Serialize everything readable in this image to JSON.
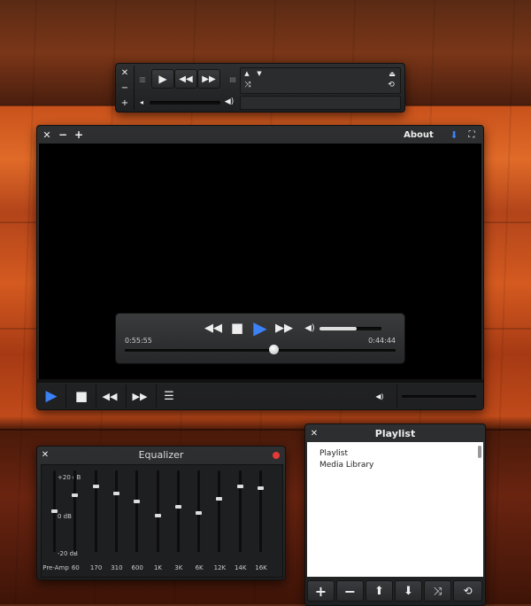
{
  "mini_player": {
    "close_icon": "close-icon",
    "minimize_icon": "minimize-icon",
    "add_icon": "plus-icon"
  },
  "main_window": {
    "about_label": "About",
    "elapsed_time": "0:55:55",
    "remaining_time": "0:44:44",
    "volume_level": 0.6,
    "seek_position": 0.55
  },
  "equalizer": {
    "title": "Equalizer",
    "db_labels": [
      "+20 dB",
      "0 dB",
      "-20 dB"
    ],
    "bands": [
      {
        "label": "Pre-Amp",
        "level": 0.5
      },
      {
        "label": "60",
        "level": 0.7
      },
      {
        "label": "170",
        "level": 0.8
      },
      {
        "label": "310",
        "level": 0.72
      },
      {
        "label": "600",
        "level": 0.62
      },
      {
        "label": "1K",
        "level": 0.45
      },
      {
        "label": "3K",
        "level": 0.55
      },
      {
        "label": "6K",
        "level": 0.48
      },
      {
        "label": "12K",
        "level": 0.65
      },
      {
        "label": "14K",
        "level": 0.8
      },
      {
        "label": "16K",
        "level": 0.78
      }
    ]
  },
  "playlist": {
    "title": "Playlist",
    "items": [
      "Playlist",
      "Media Library"
    ]
  },
  "colors": {
    "accent": "#3b82f6",
    "close_dot": "#e53935"
  }
}
